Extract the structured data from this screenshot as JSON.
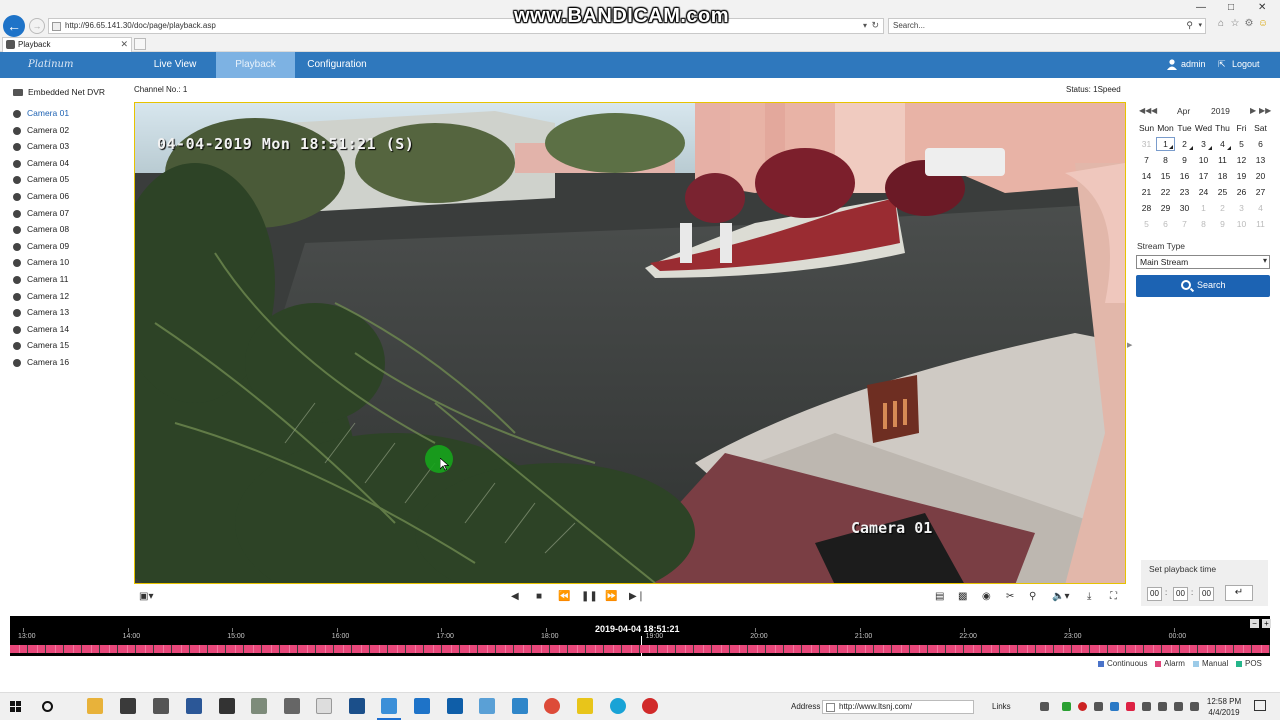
{
  "browser": {
    "watermark": "www.BANDICAM.com",
    "url": "http://96.65.141.30/doc/page/playback.asp",
    "search_placeholder": "Search...",
    "tab_title": "Playback"
  },
  "header": {
    "logo": "Platinum",
    "nav": {
      "live_view": "Live View",
      "playback": "Playback",
      "configuration": "Configuration"
    },
    "user": "admin",
    "logout": "Logout"
  },
  "sidebar": {
    "device": "Embedded Net DVR",
    "cameras": [
      "Camera 01",
      "Camera 02",
      "Camera 03",
      "Camera 04",
      "Camera 05",
      "Camera 06",
      "Camera 07",
      "Camera 08",
      "Camera 09",
      "Camera 10",
      "Camera 11",
      "Camera 12",
      "Camera 13",
      "Camera 14",
      "Camera 15",
      "Camera 16"
    ],
    "selected_index": 0
  },
  "video": {
    "channel": "Channel No.: 1",
    "status": "Status: 1Speed",
    "osd_timestamp": "04-04-2019 Mon 18:51:21 (S)",
    "osd_camera": "Camera 01"
  },
  "calendar": {
    "month": "Apr",
    "year": "2019",
    "weekdays": [
      "Sun",
      "Mon",
      "Tue",
      "Wed",
      "Thu",
      "Fri",
      "Sat"
    ],
    "weeks": [
      [
        "31",
        "1",
        "2",
        "3",
        "4",
        "5",
        "6"
      ],
      [
        "7",
        "8",
        "9",
        "10",
        "11",
        "12",
        "13"
      ],
      [
        "14",
        "15",
        "16",
        "17",
        "18",
        "19",
        "20"
      ],
      [
        "21",
        "22",
        "23",
        "24",
        "25",
        "26",
        "27"
      ],
      [
        "28",
        "29",
        "30",
        "1",
        "2",
        "3",
        "4"
      ],
      [
        "5",
        "6",
        "7",
        "8",
        "9",
        "10",
        "11"
      ]
    ],
    "today": "1",
    "record_days": [
      "1",
      "2",
      "3",
      "4"
    ]
  },
  "stream": {
    "label": "Stream Type",
    "value": "Main Stream",
    "search_label": "Search"
  },
  "playback_time": {
    "label": "Set playback time",
    "hh": "00",
    "mm": "00",
    "ss": "00",
    "sep": ":",
    "go": "↵"
  },
  "timeline": {
    "current": "2019-04-04 18:51:21",
    "ticks": [
      "13:00",
      "14:00",
      "15:00",
      "16:00",
      "17:00",
      "18:00",
      "19:00",
      "20:00",
      "21:00",
      "22:00",
      "23:00",
      "00:00"
    ],
    "legend": [
      {
        "label": "Continuous",
        "color": "#4a73c9"
      },
      {
        "label": "Alarm",
        "color": "#e0457a"
      },
      {
        "label": "Manual",
        "color": "#9ccbe8"
      },
      {
        "label": "POS",
        "color": "#25b58a"
      }
    ]
  },
  "taskbar": {
    "address_label": "Address",
    "address_value": "http://www.ltsnj.com/",
    "links": "Links",
    "time": "12:58 PM",
    "date": "4/4/2019"
  },
  "colors": {
    "header_blue": "#2f78bd",
    "active_tab": "#7db2e3",
    "search_button": "#1c63b3",
    "timeline_record": "#e8477a"
  }
}
